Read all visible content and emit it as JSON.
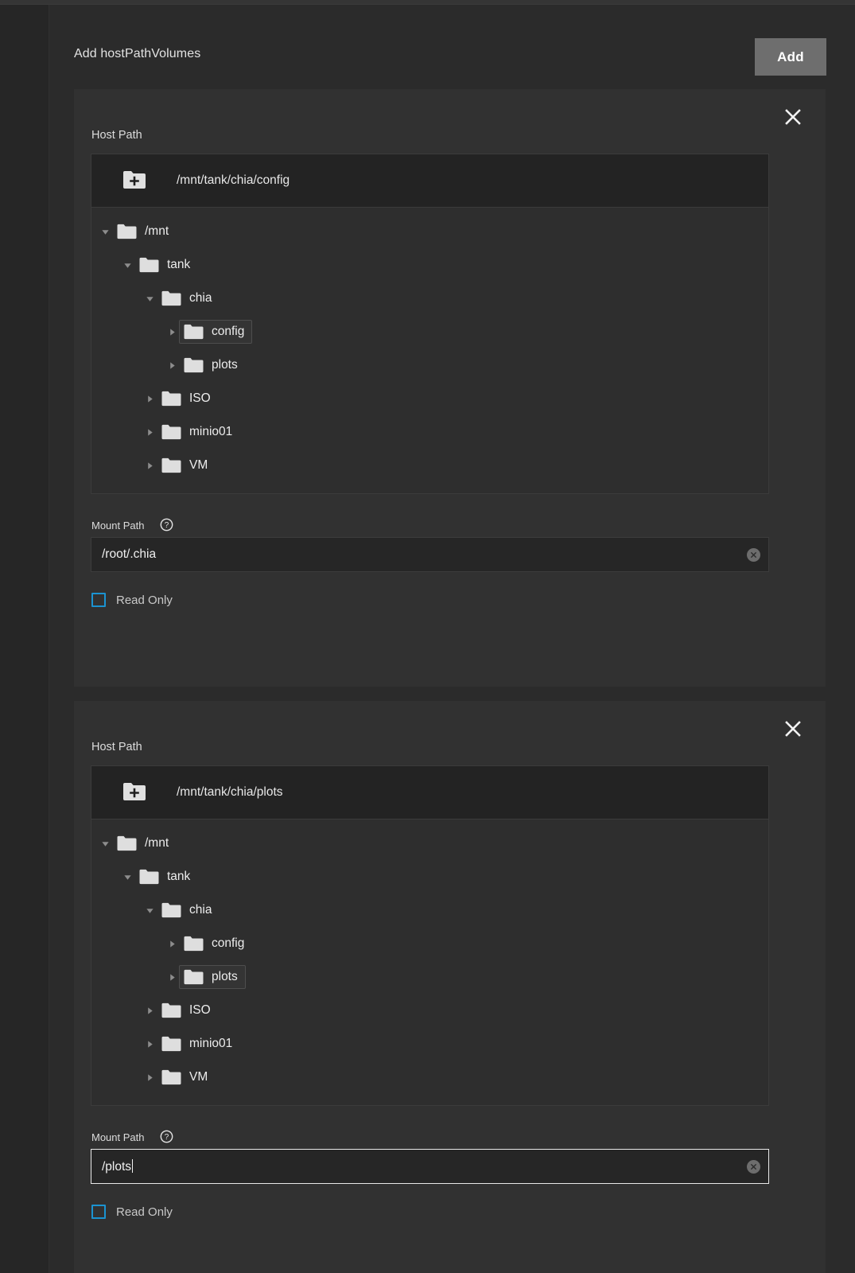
{
  "form": {
    "title": "Add hostPathVolumes",
    "add_label": "Add",
    "accent_blue": "#1b93d1",
    "button_gray": "#6e6e6e",
    "card_bg": "#313131",
    "page_bg": "#2b2b2b"
  },
  "labels": {
    "host_path": "Host Path",
    "mount_path": "Mount Path",
    "read_only": "Read Only",
    "close_icon": "close-icon",
    "help_icon": "help-circle-icon",
    "new_folder_icon": "new-folder-icon",
    "clear_icon": "clear-input-icon"
  },
  "cards": [
    {
      "host_path_label": "Host Path",
      "selected_path": "/mnt/tank/chia/config",
      "tree": [
        {
          "label": "/mnt",
          "depth": 0,
          "expanded": true,
          "selected": false
        },
        {
          "label": "tank",
          "depth": 1,
          "expanded": true,
          "selected": false
        },
        {
          "label": "chia",
          "depth": 2,
          "expanded": true,
          "selected": false
        },
        {
          "label": "config",
          "depth": 3,
          "expanded": false,
          "selected": true
        },
        {
          "label": "plots",
          "depth": 3,
          "expanded": false,
          "selected": false
        },
        {
          "label": "ISO",
          "depth": 2,
          "expanded": false,
          "selected": false
        },
        {
          "label": "minio01",
          "depth": 2,
          "expanded": false,
          "selected": false
        },
        {
          "label": "VM",
          "depth": 2,
          "expanded": false,
          "selected": false
        }
      ],
      "mount_path_label": "Mount Path",
      "mount_path_value": "/root/.chia",
      "mount_path_focused": false,
      "read_only_label": "Read Only",
      "read_only_checked": false
    },
    {
      "host_path_label": "Host Path",
      "selected_path": "/mnt/tank/chia/plots",
      "tree": [
        {
          "label": "/mnt",
          "depth": 0,
          "expanded": true,
          "selected": false
        },
        {
          "label": "tank",
          "depth": 1,
          "expanded": true,
          "selected": false
        },
        {
          "label": "chia",
          "depth": 2,
          "expanded": true,
          "selected": false
        },
        {
          "label": "config",
          "depth": 3,
          "expanded": false,
          "selected": false
        },
        {
          "label": "plots",
          "depth": 3,
          "expanded": false,
          "selected": true
        },
        {
          "label": "ISO",
          "depth": 2,
          "expanded": false,
          "selected": false
        },
        {
          "label": "minio01",
          "depth": 2,
          "expanded": false,
          "selected": false
        },
        {
          "label": "VM",
          "depth": 2,
          "expanded": false,
          "selected": false
        }
      ],
      "mount_path_label": "Mount Path",
      "mount_path_value": "/plots",
      "mount_path_focused": true,
      "read_only_label": "Read Only",
      "read_only_checked": false
    }
  ]
}
